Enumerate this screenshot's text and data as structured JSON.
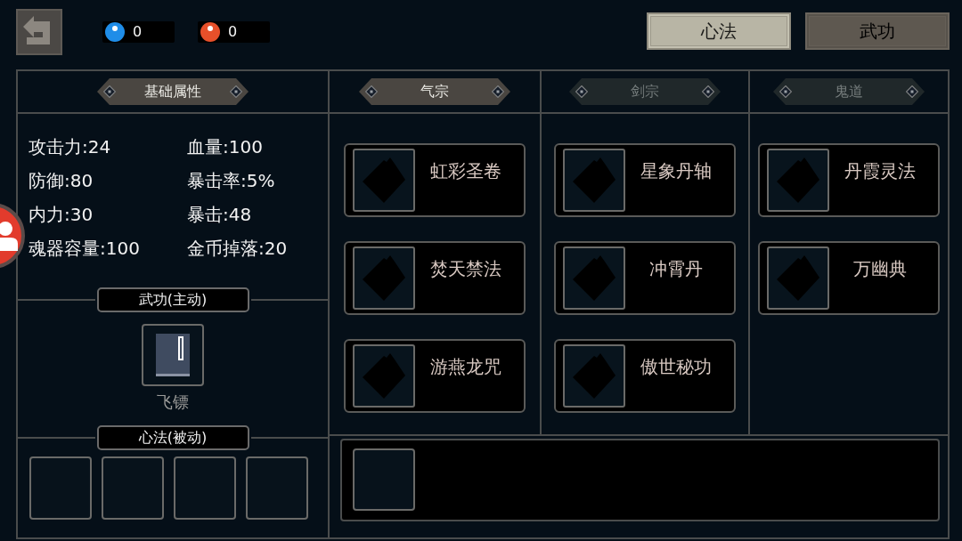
{
  "currencies": [
    {
      "value": "0",
      "color": "#1f8de8"
    },
    {
      "value": "0",
      "color": "#e8502a"
    }
  ],
  "tabs": [
    {
      "label": "心法",
      "selected": true
    },
    {
      "label": "武功",
      "selected": false
    }
  ],
  "attributes": {
    "title": "基础属性",
    "stats": [
      "攻击力:24",
      "血量:100",
      "防御:80",
      "暴击率:5%",
      "内力:30",
      "暴击:48",
      "魂器容量:100",
      "金币掉落:20"
    ]
  },
  "active_skills": {
    "title": "武功(主动)",
    "slots": [
      {
        "name": "飞镖"
      }
    ]
  },
  "passive_skills": {
    "title": "心法(被动)",
    "slots": [
      {
        "filled": false
      },
      {
        "filled": false
      },
      {
        "filled": false
      },
      {
        "filled": false
      }
    ]
  },
  "categories": [
    {
      "label": "气宗",
      "selected": true,
      "skills": [
        {
          "name": "虹彩圣卷"
        },
        {
          "name": "焚天禁法"
        },
        {
          "name": "游燕龙咒"
        }
      ]
    },
    {
      "label": "剑宗",
      "selected": false,
      "skills": [
        {
          "name": "星象丹轴"
        },
        {
          "name": "冲霄丹"
        },
        {
          "name": "傲世秘功"
        }
      ]
    },
    {
      "label": "鬼道",
      "selected": false,
      "skills": [
        {
          "name": "丹霞灵法"
        },
        {
          "name": "万幽典"
        }
      ]
    }
  ]
}
